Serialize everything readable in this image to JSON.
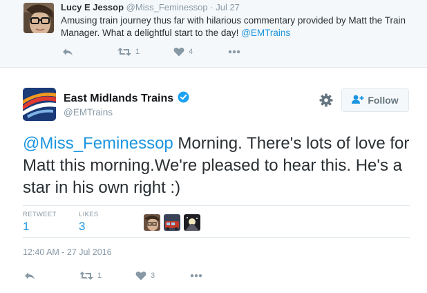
{
  "parent_tweet": {
    "name": "Lucy E Jessop",
    "handle": "@Miss_Feminessop",
    "separator": "·",
    "date": "Jul 27",
    "text": "Amusing train journey thus far with hilarious commentary provided by Matt the Train Manager. What a delightful start to the day! ",
    "mention": "@EMTrains",
    "actions": {
      "retweets": "1",
      "likes": "4"
    }
  },
  "main_tweet": {
    "name": "East Midlands Trains",
    "handle": "@EMTrains",
    "follow_label": "Follow",
    "mention": "@Miss_Feminessop",
    "text": " Morning. There's lots of love for Matt this morning.We're pleased to hear this. He's a star in his own right :)",
    "stats": {
      "retweet_label": "RETWEET",
      "retweet_count": "1",
      "likes_label": "LIKES",
      "likes_count": "3"
    },
    "timestamp": "12:40 AM - 27 Jul 2016",
    "actions": {
      "retweets": "1",
      "likes": "3"
    }
  },
  "colors": {
    "link": "#1b95e0",
    "muted": "#8899a6",
    "verified": "#1da1f2",
    "parent_bg": "#f5f8fa"
  }
}
